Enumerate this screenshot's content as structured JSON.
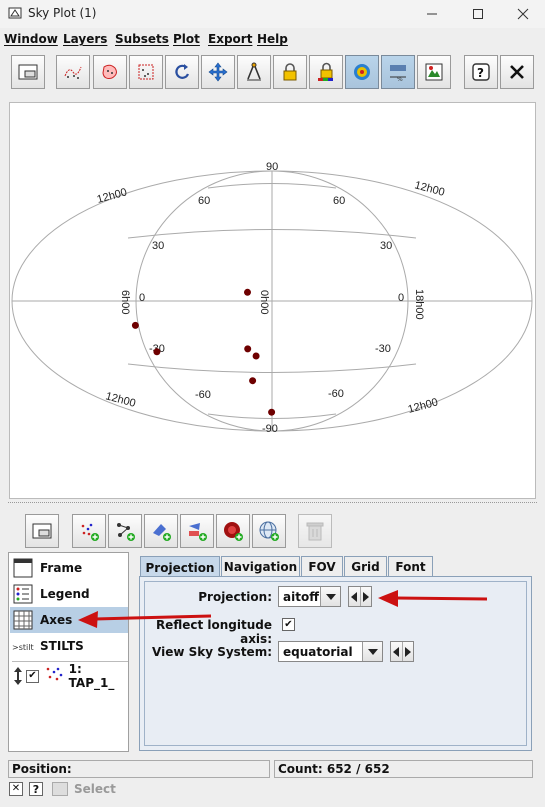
{
  "window": {
    "title": "Sky Plot (1)"
  },
  "menu": [
    "Window",
    "Layers",
    "Subsets",
    "Plot",
    "Export",
    "Help"
  ],
  "plot": {
    "top_lat_labels": [
      "90",
      "60",
      "60"
    ],
    "left_lat_labels": [
      "30",
      "0",
      "-30"
    ],
    "right_lat_labels": [
      "30",
      "0",
      "-30"
    ],
    "bottom_lat_labels": [
      "-60",
      "-60",
      "-90"
    ],
    "lon_labels": [
      "12h00",
      "12h00",
      "6h00",
      "0h00",
      "18h00",
      "12h00",
      "12h00"
    ],
    "marker_color": "#6e0000",
    "points": [
      {
        "lon": 17,
        "lat": 6
      },
      {
        "lon": 97,
        "lat": -15
      },
      {
        "lon": 90,
        "lat": -32
      },
      {
        "lon": 19,
        "lat": -33
      },
      {
        "lon": 13,
        "lat": -38
      },
      {
        "lon": 20,
        "lat": -55
      },
      {
        "lon": 1,
        "lat": -77
      }
    ]
  },
  "side_items": [
    {
      "label": "Frame"
    },
    {
      "label": "Legend"
    },
    {
      "label": "Axes"
    },
    {
      "label": "STILTS"
    },
    {
      "label": "1: TAP_1_"
    }
  ],
  "tabs": [
    "Projection",
    "Navigation",
    "FOV",
    "Grid",
    "Font"
  ],
  "form": {
    "projection_label": "Projection:",
    "projection_value": "aitoff",
    "reflect_label": "Reflect longitude axis:",
    "sky_system_label": "View Sky System:",
    "sky_system_value": "equatorial"
  },
  "status": {
    "position_label": "Position:",
    "count_label": "Count: 652 / 652"
  },
  "bottom": {
    "select_label": "Select"
  },
  "colors": {
    "accent": "#cc1111",
    "selection": "#b8cfe5",
    "tab_active": "#c7d8ea"
  }
}
